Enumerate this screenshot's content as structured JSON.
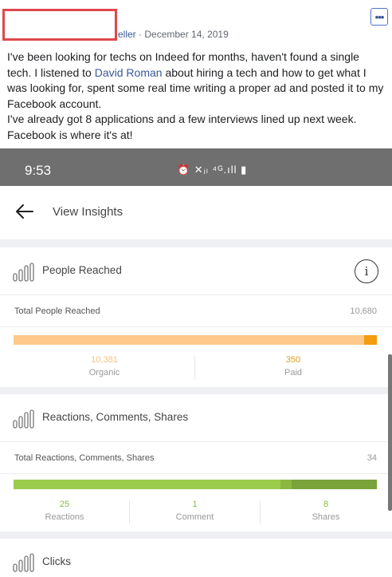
{
  "post": {
    "author_suffix": "eller",
    "date": "· December 14, 2019",
    "more_icon": "more-dots-icon",
    "body_1": "I've been looking for techs on Indeed for months, haven't found a single tech. I listened to ",
    "mention": "David Roman",
    "body_2": " about hiring a tech and how to get what I was looking for, spent some real time writing a proper ad and posted it to my Facebook account.",
    "body_3": "I've already got 8 applications and a few interviews lined up next week. Facebook is where it's at!"
  },
  "phone": {
    "time": "9:53",
    "status_icons": "⏰ ✕ᵢₗ ⁴ᴳ.ıll ▮",
    "title": "View Insights"
  },
  "reach": {
    "title": "People Reached",
    "total_label": "Total People Reached",
    "total_value": "10,680",
    "organic_value": "10,381",
    "organic_label": "Organic",
    "paid_value": "350",
    "paid_label": "Paid",
    "organic_fraction": 0.966,
    "colors": {
      "organic": "#fcc98a",
      "paid": "#f39c10",
      "organic_text": "#f5c27a",
      "paid_text": "#e0a020"
    }
  },
  "engagement": {
    "title": "Reactions, Comments, Shares",
    "total_label": "Total Reactions, Comments, Shares",
    "total_value": "34",
    "reactions_value": "25",
    "reactions_label": "Reactions",
    "comment_value": "1",
    "comment_label": "Comment",
    "shares_value": "8",
    "shares_label": "Shares",
    "fractions": {
      "reactions": 0.735,
      "comment": 0.03,
      "shares": 0.235
    },
    "colors": {
      "reactions": "#9ccc4c",
      "comment": "#8cb840",
      "shares": "#7aa33a",
      "text": "#8dbb3c"
    }
  },
  "clicks": {
    "title": "Clicks"
  }
}
